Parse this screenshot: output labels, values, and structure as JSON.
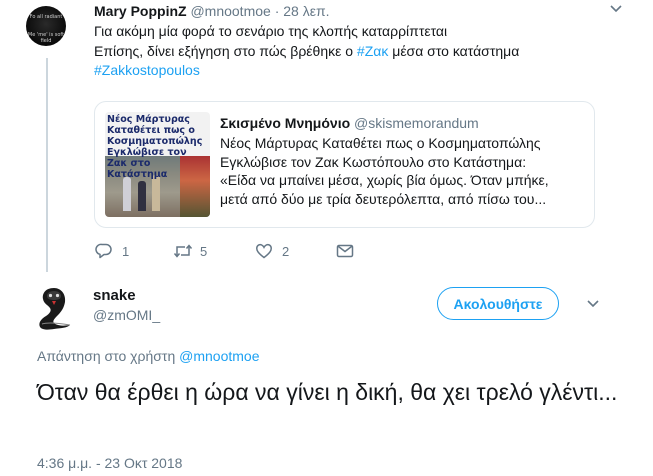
{
  "tweet": {
    "author_name": "Mary PoppinZ",
    "author_handle": "@mnootmoe",
    "time": "28 λεπ.",
    "lines": [
      "Για ακόμη μία φορά το σενάριο της κλοπής καταρρίπτεται",
      "Επίσης, δίνει εξήγηση στο πώς βρέθηκε ο ",
      "#Ζακ",
      " μέσα στο κατάστημα",
      "#Zakkostopoulos"
    ],
    "avatar_text": [
      "Fo all radiant",
      "Me 'me' is soft field"
    ],
    "quote": {
      "name": "Σκισμένο Μνημόνιο",
      "handle": "@skismemorandum",
      "text_lines": [
        "Νέος Μάρτυρας Καταθέτει πως ο Κοσμηματοπώλης",
        "Εγκλώβισε τον Ζακ Κωστόπουλο στο Κατάστημα:",
        "«Είδα να μπαίνει μέσα, χωρίς βία όμως. Όταν μπήκε,",
        "μετά από δύο με τρία δευτερόλεπτα, από πίσω του..."
      ],
      "image_headline": "Νέος Μάρτυρας Καταθέτει πως ο\nΚοσμηματοπώλης Εγκλώβισε τον\nΖακ στο Κατάστημα"
    },
    "actions": {
      "reply_count": "1",
      "retweet_count": "5",
      "like_count": "2"
    },
    "icons": [
      "reply-icon",
      "retweet-icon",
      "like-icon",
      "message-icon",
      "caret-down-icon"
    ]
  },
  "reply": {
    "author_name": "snake",
    "author_handle": "@zmOMI_",
    "follow_label": "Ακολουθήστε",
    "reply_to_prefix": "Απάντηση στο χρήστη ",
    "reply_to_handle": "@mnootmoe",
    "text": "Όταν θα έρθει η ώρα να γίνει η δική,  θα χει τρελό γλέντι...",
    "timestamp": "4:36 μ.μ. - 23 Οκτ 2018"
  },
  "colors": {
    "accent": "#1da1f2",
    "muted": "#657786",
    "text": "#14171a",
    "border": "#e1e8ed"
  }
}
